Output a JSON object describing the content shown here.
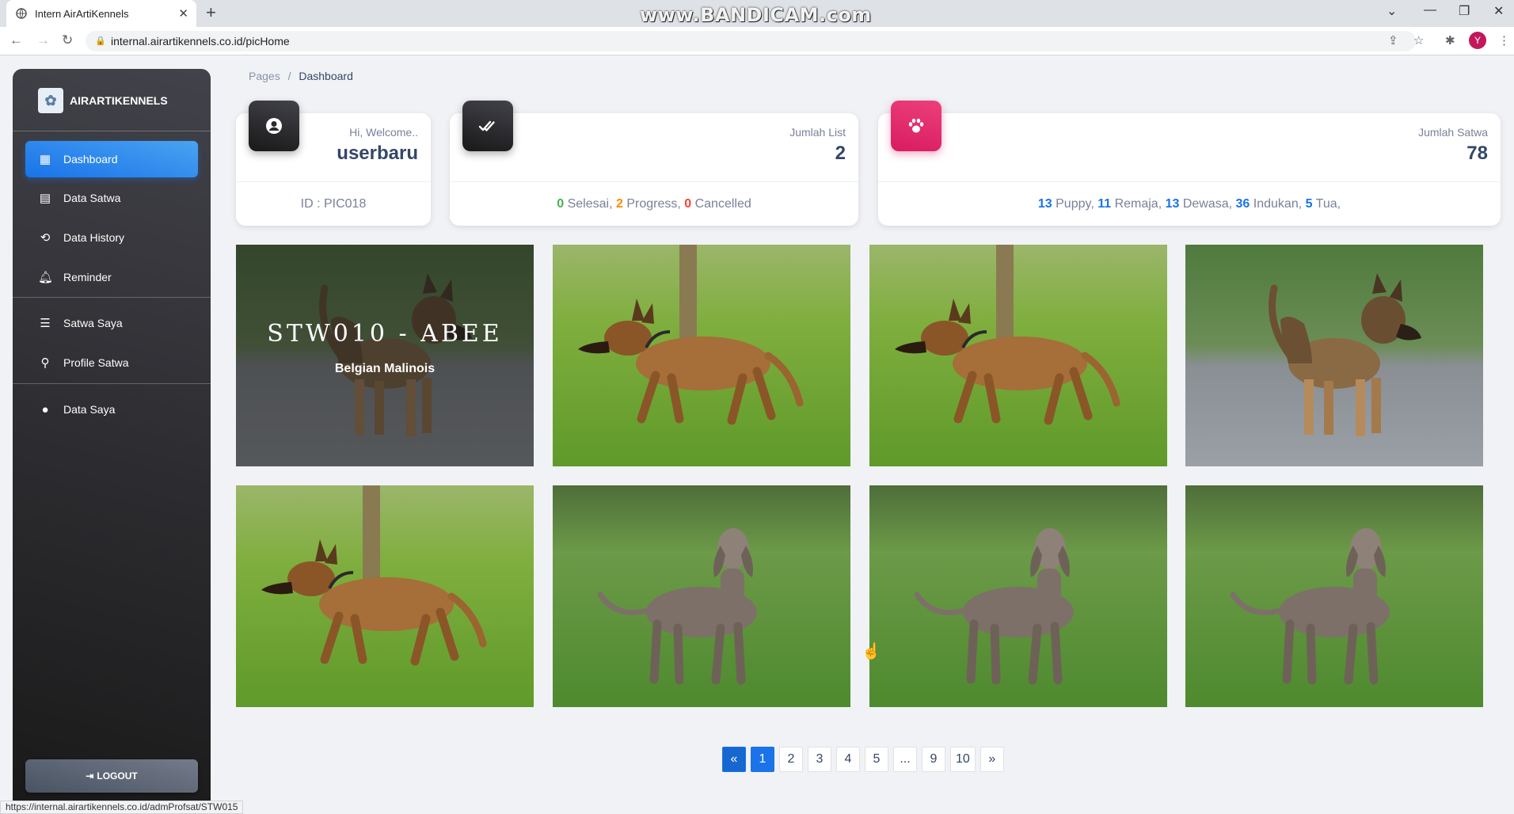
{
  "browser": {
    "tab_title": "Intern AirArtiKennels",
    "url": "internal.airartikennels.co.id/picHome",
    "profile_initial": "Y",
    "watermark": "www.BANDICAM.com",
    "status_url": "https://internal.airartikennels.co.id/admProfsat/STW015"
  },
  "sidebar": {
    "brand": "AIRARTIKENNELS",
    "items": [
      {
        "label": "Dashboard",
        "icon": "dashboard-icon"
      },
      {
        "label": "Data Satwa",
        "icon": "table-icon"
      },
      {
        "label": "Data History",
        "icon": "history-icon"
      },
      {
        "label": "Reminder",
        "icon": "bell-icon"
      },
      {
        "label": "Satwa Saya",
        "icon": "list-icon"
      },
      {
        "label": "Profile Satwa",
        "icon": "search-icon"
      },
      {
        "label": "Data Saya",
        "icon": "user-circle-icon"
      }
    ],
    "logout": "LOGOUT"
  },
  "breadcrumb": {
    "root": "Pages",
    "sep": "/",
    "current": "Dashboard"
  },
  "cards": {
    "welcome": {
      "label": "Hi, Welcome..",
      "value": "userbaru",
      "footer": "ID : PIC018"
    },
    "list": {
      "label": "Jumlah List",
      "value": "2",
      "selesai_n": "0",
      "selesai": " Selesai, ",
      "progress_n": "2",
      "progress": " Progress, ",
      "cancel_n": "0",
      "cancel": " Cancelled"
    },
    "satwa": {
      "label": "Jumlah Satwa",
      "value": "78",
      "puppy_n": "13",
      "puppy": " Puppy, ",
      "remaja_n": "11",
      "remaja": " Remaja, ",
      "dewasa_n": "13",
      "dewasa": " Dewasa, ",
      "indukan_n": "36",
      "indukan": " Indukan, ",
      "tua_n": "5",
      "tua": " Tua,"
    }
  },
  "gallery": {
    "hover": {
      "title": "STW010 - ABEE",
      "breed": "Belgian Malinois"
    }
  },
  "pagination": [
    "«",
    "1",
    "2",
    "3",
    "4",
    "5",
    "...",
    "9",
    "10",
    "»"
  ],
  "colors": {
    "accent": "#1A73E8",
    "pink": "#D81B60",
    "success": "#4CAF50",
    "warning": "#fb8c00",
    "danger": "#F44335"
  }
}
